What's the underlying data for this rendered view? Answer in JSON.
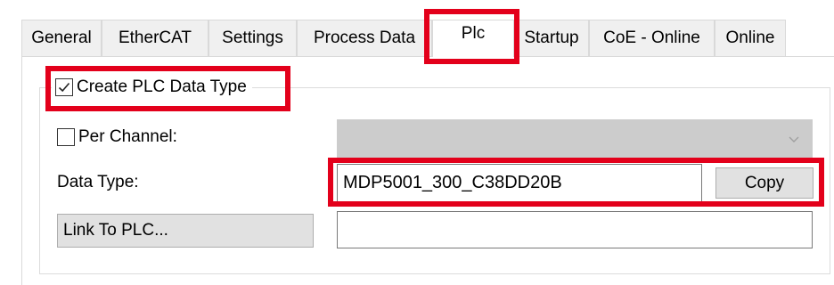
{
  "tabs": [
    {
      "label": "General"
    },
    {
      "label": "EtherCAT"
    },
    {
      "label": "Settings"
    },
    {
      "label": "Process Data"
    },
    {
      "label": "Plc",
      "active": true
    },
    {
      "label": "Startup"
    },
    {
      "label": "CoE - Online"
    },
    {
      "label": "Online"
    }
  ],
  "plc": {
    "create_plc_data_type": {
      "label": "Create PLC Data Type",
      "checked": true
    },
    "per_channel": {
      "label": "Per Channel:",
      "checked": false,
      "selected_value": ""
    },
    "data_type": {
      "label": "Data Type:",
      "value": "MDP5001_300_C38DD20B",
      "copy_label": "Copy"
    },
    "link_to_plc": {
      "label": "Link To PLC...",
      "value": ""
    }
  },
  "highlight_color": "#e3001b",
  "icons": {
    "checkmark": "check-icon",
    "dropdown": "chevron-down-icon"
  }
}
